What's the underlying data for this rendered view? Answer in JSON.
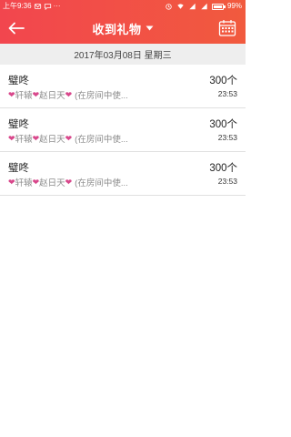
{
  "status_bar": {
    "time": "上午9:36",
    "battery_percent": "99%",
    "battery_level": 0.99
  },
  "header": {
    "title": "收到礼物",
    "back_icon": "arrow-left-icon",
    "dropdown_icon": "caret-down-icon",
    "calendar_icon": "calendar-icon",
    "accent_color": "#f2464e"
  },
  "date_bar": {
    "text": "2017年03月08日 星期三"
  },
  "gifts": [
    {
      "name": "璧咚",
      "sender_a": "轩辕",
      "sender_b": "赵日天",
      "note": "(在房间中使...",
      "amount": "300个",
      "time": "23:53"
    },
    {
      "name": "璧咚",
      "sender_a": "轩辕",
      "sender_b": "赵日天",
      "note": "(在房间中使...",
      "amount": "300个",
      "time": "23:53"
    },
    {
      "name": "璧咚",
      "sender_a": "轩辕",
      "sender_b": "赵日天",
      "note": "(在房间中使...",
      "amount": "300个",
      "time": "23:53"
    }
  ]
}
